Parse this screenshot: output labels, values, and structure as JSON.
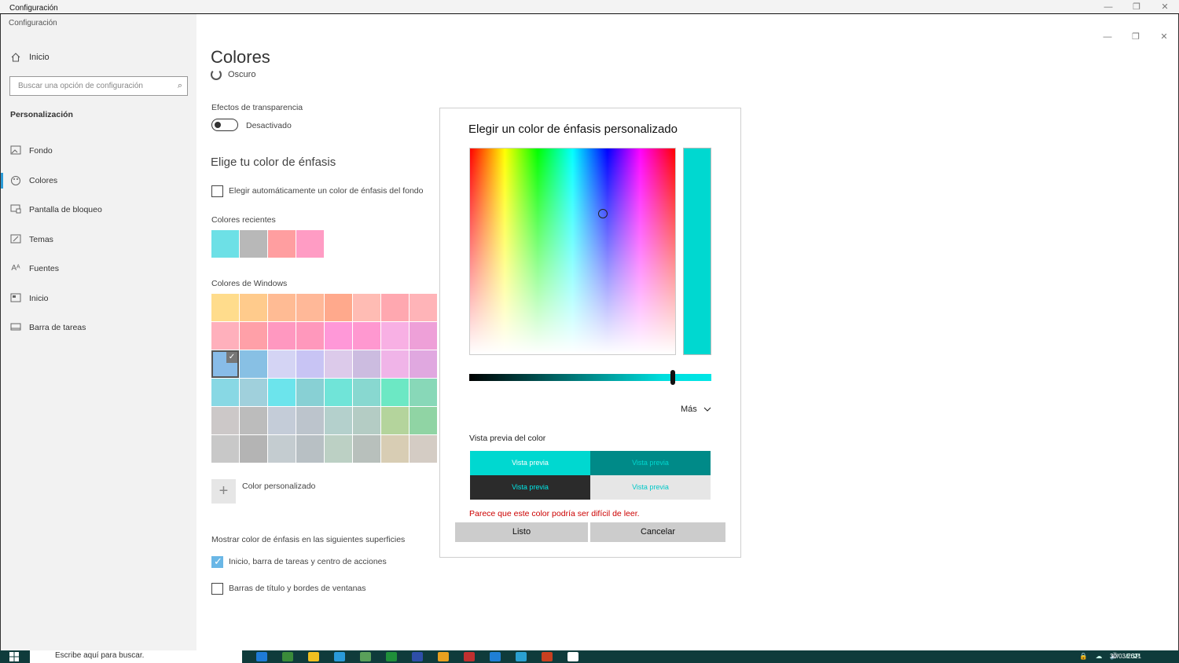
{
  "window": {
    "title": "Configuración",
    "inner_title": "Configuración",
    "minimize": "—",
    "restore": "❐",
    "close": "✕"
  },
  "sidebar": {
    "home_label": "Inicio",
    "search_placeholder": "Buscar una opción de configuración",
    "section": "Personalización",
    "items": [
      {
        "label": "Fondo",
        "icon": "image-icon"
      },
      {
        "label": "Colores",
        "icon": "palette-icon",
        "active": true
      },
      {
        "label": "Pantalla de bloqueo",
        "icon": "lock-screen-icon"
      },
      {
        "label": "Temas",
        "icon": "themes-icon"
      },
      {
        "label": "Fuentes",
        "icon": "fonts-icon"
      },
      {
        "label": "Inicio",
        "icon": "start-icon"
      },
      {
        "label": "Barra de tareas",
        "icon": "taskbar-icon"
      }
    ]
  },
  "main": {
    "title": "Colores",
    "mode_option": "Oscuro",
    "transparency_label": "Efectos de transparencia",
    "transparency_state": "Desactivado",
    "accent_heading": "Elige tu color de énfasis",
    "auto_accent_label": "Elegir automáticamente un color de énfasis del fondo",
    "recent_label": "Colores recientes",
    "recent_colors": [
      "#6de0e6",
      "#b8b8b8",
      "#ff9ea0",
      "#ff9cc4"
    ],
    "windows_colors_label": "Colores de Windows",
    "windows_colors": [
      "#ffdc8c",
      "#ffcb8c",
      "#ffbb94",
      "#ffb898",
      "#ffa98c",
      "#ffbcb4",
      "#ffa8b0",
      "#ffb4b8",
      "#ffb0bc",
      "#ffa0a8",
      "#ff98c0",
      "#ff98bc",
      "#ff98d8",
      "#ff98d0",
      "#f8b0e4",
      "#eea0d8",
      "#88bce8",
      "#88c0e4",
      "#d4d4f4",
      "#c8c4f4",
      "#dccaea",
      "#ccbce0",
      "#f0b4e8",
      "#e0a8e0",
      "#88d8e4",
      "#a0d0dc",
      "#6ce4ec",
      "#88d0d4",
      "#70e4d8",
      "#88d8d0",
      "#6ce8c4",
      "#88d8b8",
      "#ccc8c8",
      "#bcbcbc",
      "#c4ccd8",
      "#bcc4cc",
      "#b4d0cc",
      "#b4ccc4",
      "#b4d49c",
      "#90d4a4",
      "#c8c8c8",
      "#b4b4b4",
      "#c4ccd0",
      "#b8c0c4",
      "#bcd0c4",
      "#b8c0bc",
      "#d8cdb4",
      "#d4ccc4"
    ],
    "selected_index": 16,
    "custom_color_label": "Color personalizado",
    "surfaces_label": "Mostrar color de énfasis en las siguientes superficies",
    "surface_1": "Inicio, barra de tareas y centro de acciones",
    "surface_1_checked": true,
    "surface_2": "Barras de título y bordes de ventanas",
    "surface_2_checked": false
  },
  "dialog": {
    "title": "Elegir un color de énfasis personalizado",
    "current_color": "#00d8d0",
    "value_level": 0.84,
    "more_label": "Más",
    "preview_label": "Vista previa del color",
    "previews": [
      {
        "text": "Vista previa",
        "bg": "#00d8d0",
        "fg": "#ffffff"
      },
      {
        "text": "Vista previa",
        "bg": "#008a88",
        "fg": "#00d8d0"
      },
      {
        "text": "Vista previa",
        "bg": "#2b2b2b",
        "fg": "#00e6e6"
      },
      {
        "text": "Vista previa",
        "bg": "#e6e6e6",
        "fg": "#00c8c8"
      }
    ],
    "warning": "Parece que este color podría ser difícil de leer.",
    "ok_label": "Listo",
    "cancel_label": "Cancelar"
  },
  "taskbar": {
    "search_text": "Escribe aquí para buscar.",
    "clock": "30/03/2021",
    "tray": [
      "🔒",
      "☁",
      "🔊",
      "ESP"
    ],
    "app_colors": [
      "#1e7bd6",
      "#3a8b3a",
      "#f0c020",
      "#2a9ad8",
      "#5aa05a",
      "#1f8f3a",
      "#2e4fa8",
      "#e8a020",
      "#c03030",
      "#1f7fd6",
      "#2aa0d0",
      "#c84020",
      "#ffffff"
    ]
  }
}
